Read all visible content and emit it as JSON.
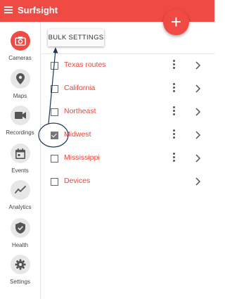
{
  "app": {
    "title": "Surfsight"
  },
  "fab": {
    "symbol": "+"
  },
  "sidebar": {
    "items": [
      {
        "label": "Cameras",
        "icon": "camera-icon",
        "active": true
      },
      {
        "label": "Maps",
        "icon": "map-pin-icon",
        "active": false
      },
      {
        "label": "Recordings",
        "icon": "video-camera-icon",
        "active": false
      },
      {
        "label": "Events",
        "icon": "calendar-icon",
        "active": false
      },
      {
        "label": "Analytics",
        "icon": "trend-line-icon",
        "active": false
      },
      {
        "label": "Health",
        "icon": "shield-check-icon",
        "active": false
      },
      {
        "label": "Settings",
        "icon": "gear-icon",
        "active": false
      }
    ]
  },
  "toolbar": {
    "bulk_settings_label": "BULK SETTINGS"
  },
  "groups": [
    {
      "name": "Texas routes",
      "checked": false,
      "has_menu": true
    },
    {
      "name": "California",
      "checked": false,
      "has_menu": true
    },
    {
      "name": "Northeast",
      "checked": false,
      "has_menu": true
    },
    {
      "name": "Midwest",
      "checked": true,
      "has_menu": true
    },
    {
      "name": "Mississippi",
      "checked": false,
      "has_menu": true
    },
    {
      "name": "Devices",
      "checked": false,
      "has_menu": false
    }
  ],
  "colors": {
    "brand": "#f04a45",
    "link": "#e8453c",
    "annotation": "#1d3557"
  }
}
